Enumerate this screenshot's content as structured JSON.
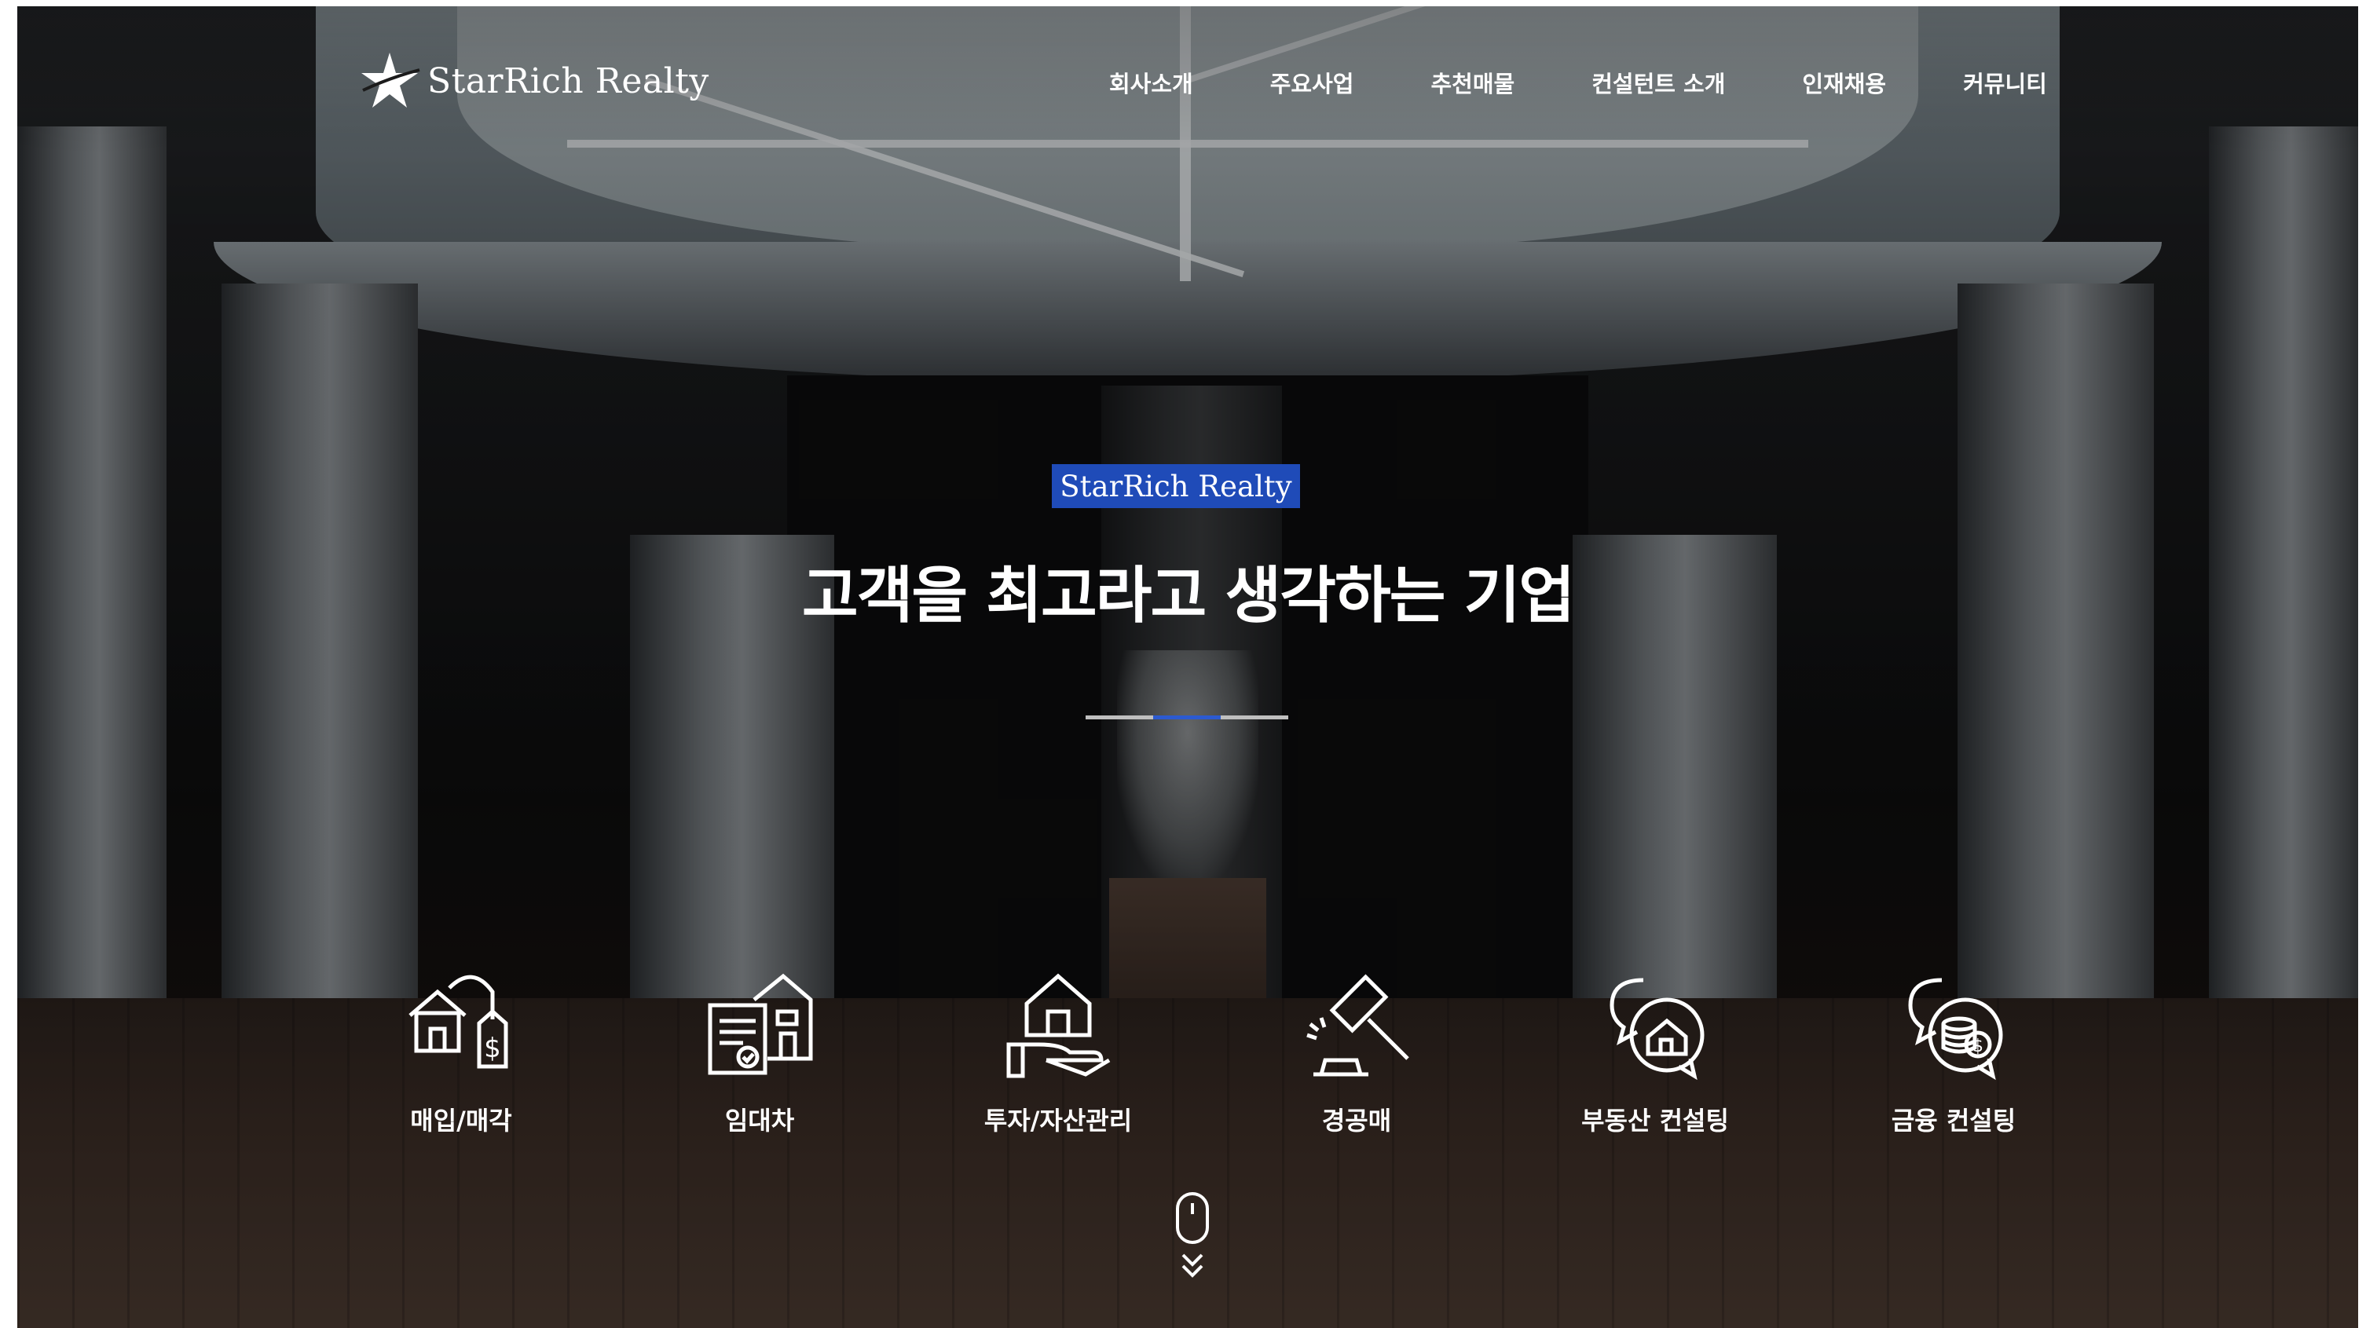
{
  "brand": {
    "name": "StarRich Realty",
    "accent": "#1f4bb8"
  },
  "nav": {
    "items": [
      {
        "label": "회사소개"
      },
      {
        "label": "주요사업"
      },
      {
        "label": "추천매물"
      },
      {
        "label": "컨설턴트 소개"
      },
      {
        "label": "인재채용"
      },
      {
        "label": "커뮤니티"
      }
    ]
  },
  "hero": {
    "badge": "StarRich Realty",
    "title": "고객을 최고라고 생각하는 기업",
    "slides": {
      "count": 3,
      "active_index": 2
    }
  },
  "services": [
    {
      "label": "매입/매각",
      "icon": "house-price-tag-icon"
    },
    {
      "label": "임대차",
      "icon": "lease-contract-building-icon"
    },
    {
      "label": "투자/자산관리",
      "icon": "hand-holding-house-icon"
    },
    {
      "label": "경공매",
      "icon": "auction-gavel-icon"
    },
    {
      "label": "부동산 컨설팅",
      "icon": "chat-house-icon"
    },
    {
      "label": "금융 컨설팅",
      "icon": "chat-coins-icon"
    }
  ],
  "scroll_hint": {
    "icon": "mouse-scroll-icon"
  }
}
